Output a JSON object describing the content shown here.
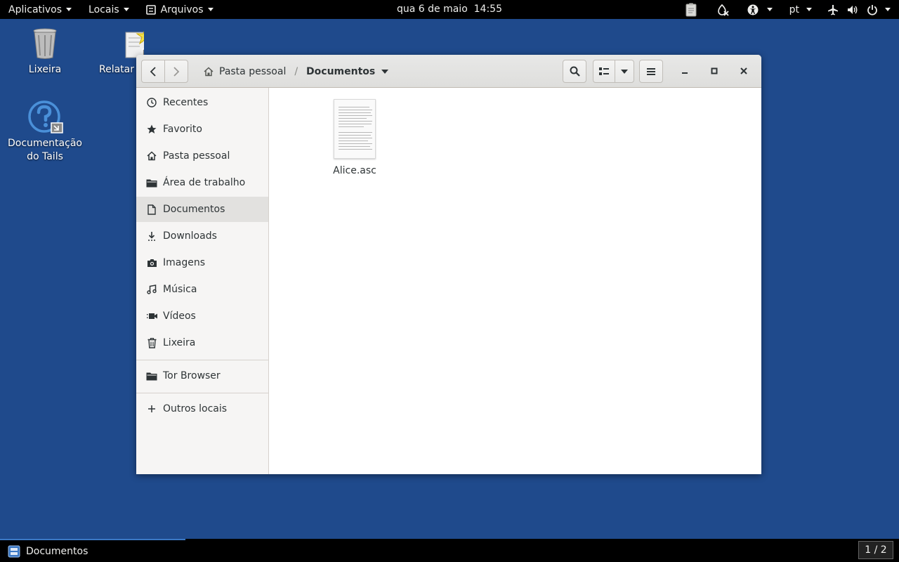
{
  "topbar": {
    "menus": [
      "Aplicativos",
      "Locais",
      "Arquivos"
    ],
    "clock": "qua 6 de maio  14:55",
    "language": "pt"
  },
  "desktop": {
    "icons": [
      {
        "label": "Lixeira",
        "icon": "trash-icon"
      },
      {
        "label": "Relatar u",
        "icon": "bug-report-icon"
      },
      {
        "label": "Documentação do Tails",
        "icon": "help-icon"
      }
    ]
  },
  "window": {
    "path": {
      "home_label": "Pasta pessoal",
      "separator": "/",
      "current_label": "Documentos"
    },
    "sidebar": {
      "items": [
        {
          "label": "Recentes",
          "icon": "clock-icon"
        },
        {
          "label": "Favorito",
          "icon": "star-icon"
        },
        {
          "label": "Pasta pessoal",
          "icon": "home-icon"
        },
        {
          "label": "Área de trabalho",
          "icon": "folder-icon"
        },
        {
          "label": "Documentos",
          "icon": "document-icon",
          "selected": true
        },
        {
          "label": "Downloads",
          "icon": "download-icon"
        },
        {
          "label": "Imagens",
          "icon": "camera-icon"
        },
        {
          "label": "Música",
          "icon": "music-icon"
        },
        {
          "label": "Vídeos",
          "icon": "video-icon"
        },
        {
          "label": "Lixeira",
          "icon": "trash-icon"
        }
      ],
      "bookmarks": [
        {
          "label": "Tor Browser",
          "icon": "folder-icon"
        }
      ],
      "other": {
        "label": "Outros locais",
        "icon": "plus-icon"
      }
    },
    "files": [
      {
        "name": "Alice.asc",
        "icon": "text-file-icon"
      }
    ]
  },
  "taskbar": {
    "task_label": "Documentos",
    "workspace": "1 / 2"
  },
  "colors": {
    "desktop_bg": "#1f4a8c",
    "panel_bg": "#000000",
    "sidebar_bg": "#f6f5f4",
    "selected_bg": "#e2e1df",
    "accent": "#3b78c4"
  }
}
